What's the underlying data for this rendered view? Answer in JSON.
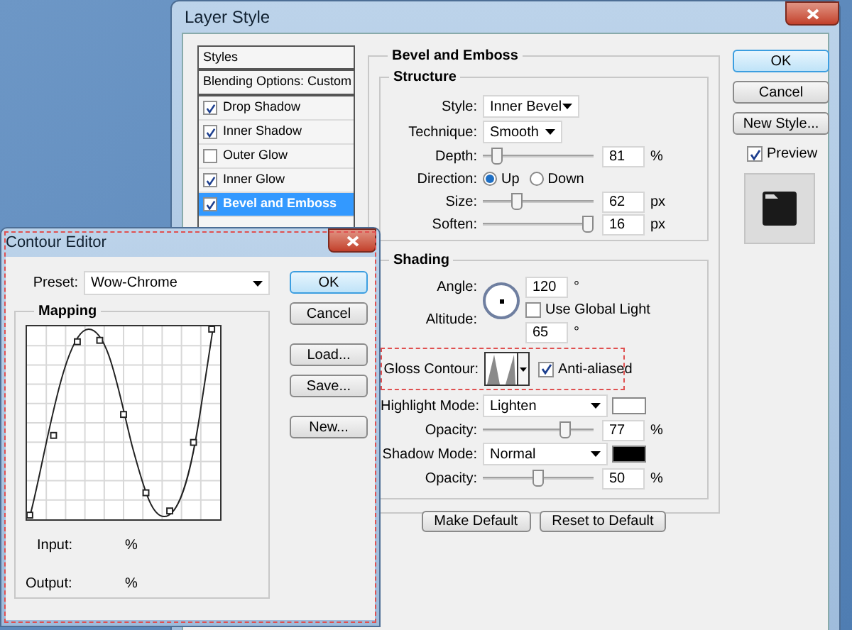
{
  "layer_style": {
    "title": "Layer Style",
    "styles_list": [
      {
        "label": "Styles",
        "kind": "header",
        "selected": false
      },
      {
        "label": "Blending Options: Custom",
        "kind": "header",
        "selected": false
      },
      {
        "label": "Drop Shadow",
        "kind": "check",
        "checked": true,
        "selected": false
      },
      {
        "label": "Inner Shadow",
        "kind": "check",
        "checked": true,
        "selected": false
      },
      {
        "label": "Outer Glow",
        "kind": "check",
        "checked": false,
        "selected": false
      },
      {
        "label": "Inner Glow",
        "kind": "check",
        "checked": true,
        "selected": false
      },
      {
        "label": "Bevel and Emboss",
        "kind": "check",
        "checked": true,
        "selected": true
      }
    ],
    "section_title": "Bevel and Emboss",
    "structure": {
      "title": "Structure",
      "style": {
        "label": "Style:",
        "value": "Inner Bevel"
      },
      "technique": {
        "label": "Technique:",
        "value": "Smooth"
      },
      "depth": {
        "label": "Depth:",
        "level": 0.08,
        "value": "81",
        "unit": "%"
      },
      "direction": {
        "label": "Direction:",
        "options": [
          {
            "label": "Up",
            "selected": true
          },
          {
            "label": "Down",
            "selected": false
          }
        ]
      },
      "size": {
        "label": "Size:",
        "level": 0.29,
        "value": "62",
        "unit": "px"
      },
      "soften": {
        "label": "Soften:",
        "level": 1.0,
        "value": "16",
        "unit": "px"
      }
    },
    "shading": {
      "title": "Shading",
      "angle": {
        "label": "Angle:",
        "value": "120",
        "unit": "°"
      },
      "global_light": {
        "label": "Use Global Light",
        "checked": false
      },
      "altitude": {
        "label": "Altitude:",
        "value": "65",
        "unit": "°"
      },
      "gloss_contour": {
        "label": "Gloss Contour:"
      },
      "anti_aliased": {
        "label": "Anti-aliased",
        "checked": true
      },
      "highlight_mode": {
        "label": "Highlight Mode:",
        "value": "Lighten",
        "color": "#ffffff"
      },
      "highlight_opacity": {
        "label": "Opacity:",
        "level": 0.77,
        "value": "77",
        "unit": "%"
      },
      "shadow_mode": {
        "label": "Shadow Mode:",
        "value": "Normal",
        "color": "#000000"
      },
      "shadow_opacity": {
        "label": "Opacity:",
        "level": 0.5,
        "value": "50",
        "unit": "%"
      }
    },
    "bottom_buttons": [
      "Make Default",
      "Reset to Default"
    ],
    "side_buttons": [
      {
        "label": "OK",
        "focused": true
      },
      {
        "label": "Cancel",
        "focused": false
      },
      {
        "label": "New Style...",
        "focused": false
      }
    ],
    "preview": {
      "label": "Preview",
      "checked": true
    }
  },
  "contour_editor": {
    "title": "Contour Editor",
    "preset": {
      "label": "Preset:",
      "value": "Wow-Chrome"
    },
    "buttons": [
      {
        "label": "OK",
        "focused": true
      },
      {
        "label": "Cancel",
        "focused": false
      },
      {
        "label": "Load...",
        "focused": false
      },
      {
        "label": "Save...",
        "focused": false
      },
      {
        "label": "New...",
        "focused": false
      }
    ],
    "mapping": {
      "title": "Mapping",
      "input_label": "Input:",
      "input_unit": "%",
      "output_label": "Output:",
      "output_unit": "%"
    }
  }
}
